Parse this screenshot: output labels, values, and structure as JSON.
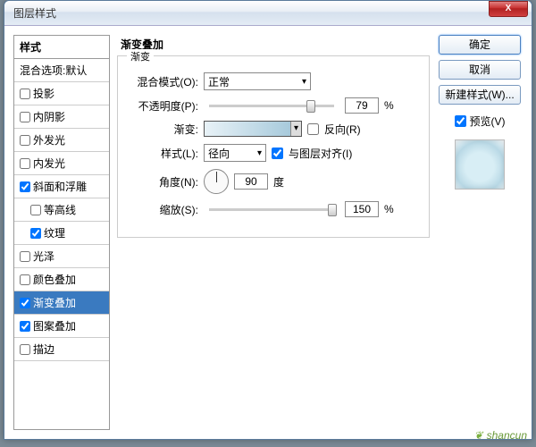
{
  "window": {
    "title": "图层样式"
  },
  "left": {
    "header": "样式",
    "blend_options": "混合选项:默认",
    "items": [
      {
        "label": "投影",
        "checked": false,
        "indent": false
      },
      {
        "label": "内阴影",
        "checked": false,
        "indent": false
      },
      {
        "label": "外发光",
        "checked": false,
        "indent": false
      },
      {
        "label": "内发光",
        "checked": false,
        "indent": false
      },
      {
        "label": "斜面和浮雕",
        "checked": true,
        "indent": false
      },
      {
        "label": "等高线",
        "checked": false,
        "indent": true
      },
      {
        "label": "纹理",
        "checked": true,
        "indent": true
      },
      {
        "label": "光泽",
        "checked": false,
        "indent": false
      },
      {
        "label": "颜色叠加",
        "checked": false,
        "indent": false
      },
      {
        "label": "渐变叠加",
        "checked": true,
        "indent": false,
        "selected": true
      },
      {
        "label": "图案叠加",
        "checked": true,
        "indent": false
      },
      {
        "label": "描边",
        "checked": false,
        "indent": false
      }
    ]
  },
  "mid": {
    "title": "渐变叠加",
    "legend": "渐变",
    "blend_mode_label": "混合模式(O):",
    "blend_mode_value": "正常",
    "opacity_label": "不透明度(P):",
    "opacity_value": "79",
    "opacity_unit": "%",
    "gradient_label": "渐变:",
    "reverse_label": "反向(R)",
    "reverse_checked": false,
    "style_label": "样式(L):",
    "style_value": "径向",
    "align_label": "与图层对齐(I)",
    "align_checked": true,
    "angle_label": "角度(N):",
    "angle_value": "90",
    "angle_unit": "度",
    "scale_label": "缩放(S):",
    "scale_value": "150",
    "scale_unit": "%"
  },
  "right": {
    "ok": "确定",
    "cancel": "取消",
    "new_style": "新建样式(W)...",
    "preview_label": "预览(V)",
    "preview_checked": true
  },
  "watermark": "shancun"
}
